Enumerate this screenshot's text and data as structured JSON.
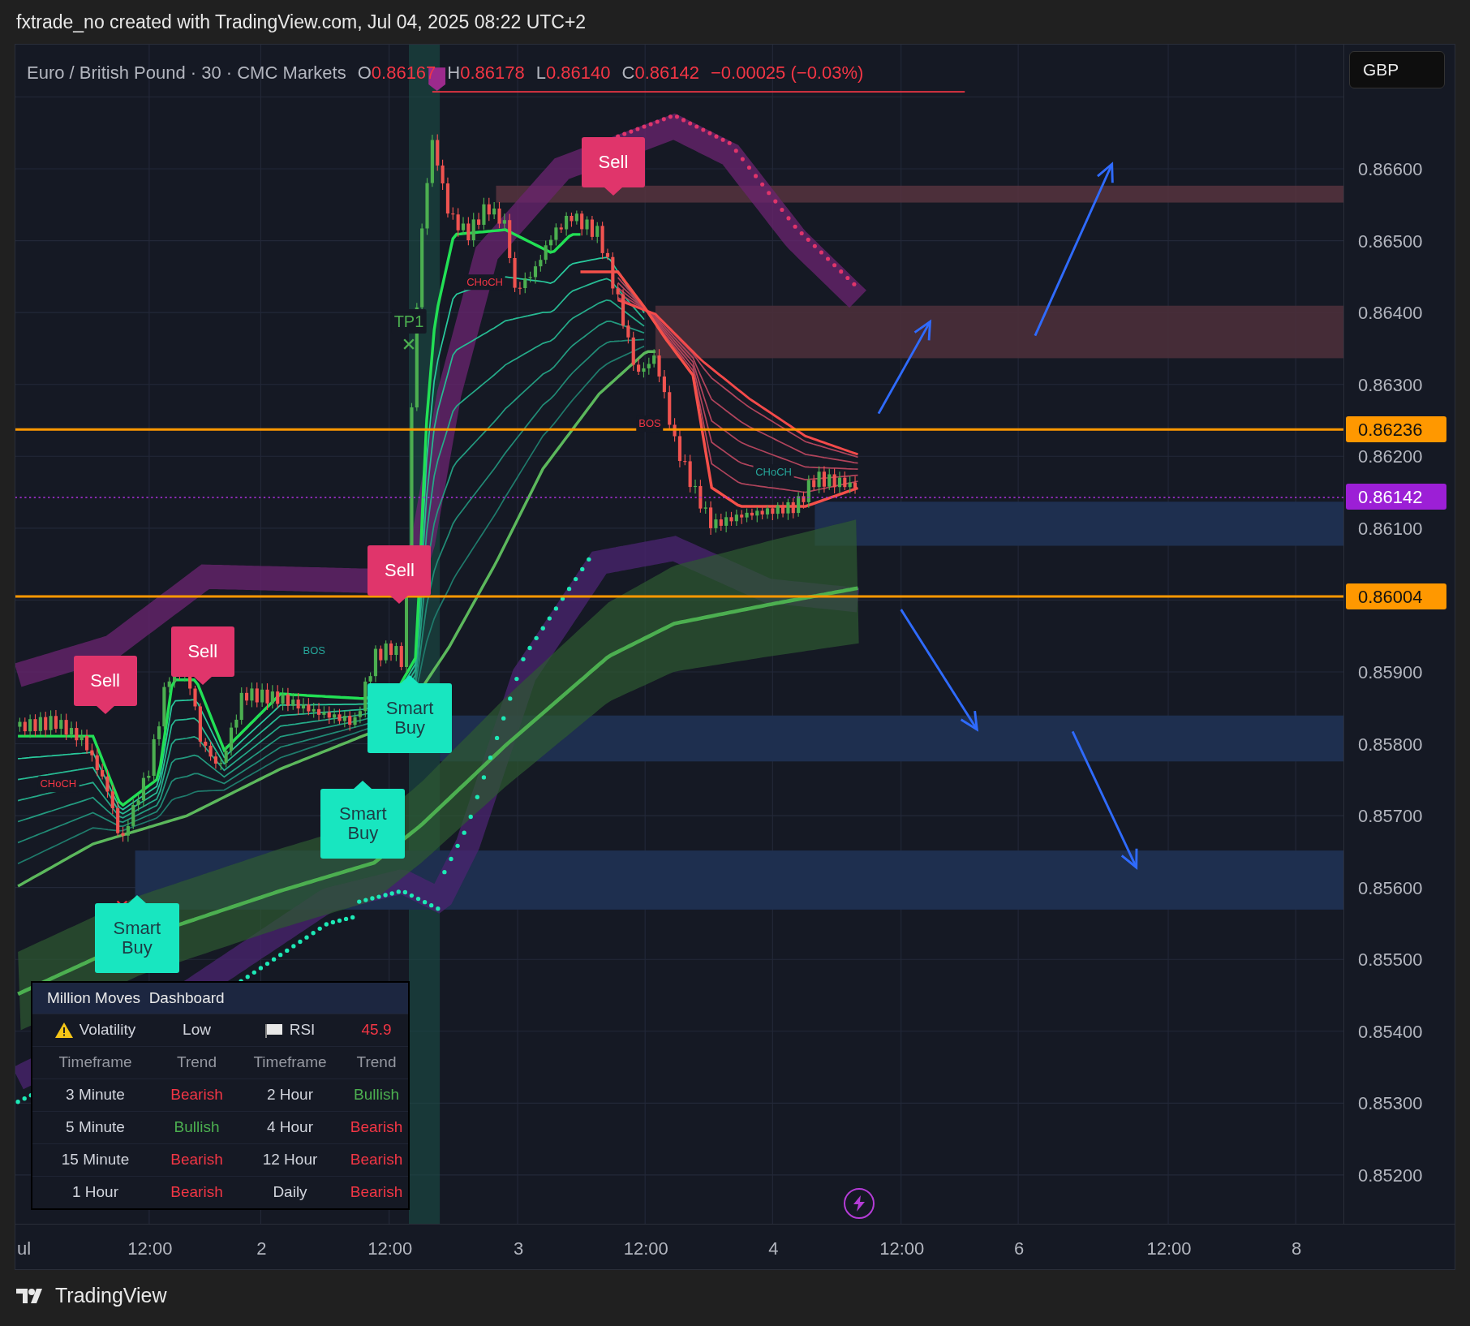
{
  "title_bar": {
    "text": "fxtrade_no created with TradingView.com, Jul 04, 2025 08:22 UTC+2"
  },
  "legend": {
    "symbol": "Euro / British Pound · 30 · CMC Markets",
    "ohlc": [
      {
        "label": "O",
        "value": "0.86167"
      },
      {
        "label": "H",
        "value": "0.86178"
      },
      {
        "label": "L",
        "value": "0.86140"
      },
      {
        "label": "C",
        "value": "0.86142"
      }
    ],
    "change": "−0.00025 (−0.03%)"
  },
  "currency_button": "GBP",
  "price_axis": {
    "labels": [
      "0.86600",
      "0.86500",
      "0.86400",
      "0.86300",
      "0.86200",
      "0.86100",
      "0.85900",
      "0.85800",
      "0.85700",
      "0.85600",
      "0.85500",
      "0.85400",
      "0.85300",
      "0.85200"
    ],
    "tags": [
      {
        "text": "0.86236",
        "color": "#ff9800"
      },
      {
        "text": "0.86142",
        "color": "#9c1fd6"
      },
      {
        "text": "0.86004",
        "color": "#ff9800"
      }
    ]
  },
  "time_axis": {
    "labels": [
      "ul",
      "12:00",
      "2",
      "12:00",
      "3",
      "12:00",
      "4",
      "12:00",
      "6",
      "12:00",
      "8"
    ]
  },
  "signals": [
    {
      "kind": "sell",
      "text": "Sell"
    },
    {
      "kind": "sell",
      "text": "Sell"
    },
    {
      "kind": "sell",
      "text": "Sell"
    },
    {
      "kind": "sell",
      "text": "Sell"
    },
    {
      "kind": "buy",
      "text": "Smart Buy"
    },
    {
      "kind": "buy",
      "text": "Smart Buy"
    },
    {
      "kind": "buy",
      "text": "Smart Buy"
    }
  ],
  "chart_labels": [
    {
      "text": "CHoCH",
      "color": "#f23645"
    },
    {
      "text": "CHoCH",
      "color": "#f23645"
    },
    {
      "text": "BOS",
      "color": "#26a69a"
    },
    {
      "text": "BOS",
      "color": "#f23645"
    },
    {
      "text": "CHoCH",
      "color": "#26a69a"
    },
    {
      "text": "TP1",
      "color": "#4caf50"
    }
  ],
  "dashboard": {
    "title": "Million Moves  Dashboard",
    "rows": [
      [
        {
          "text": "Volatility",
          "color": "#d1d4dc"
        },
        {
          "text": "Low",
          "color": "#d1d4dc"
        },
        {
          "text": "RSI",
          "color": "#d1d4dc"
        },
        {
          "text": "45.9",
          "color": "#f23645"
        }
      ],
      [
        {
          "text": "Timeframe",
          "color": "#9598a1"
        },
        {
          "text": "Trend",
          "color": "#9598a1"
        },
        {
          "text": "Timeframe",
          "color": "#9598a1"
        },
        {
          "text": "Trend",
          "color": "#9598a1"
        }
      ],
      [
        {
          "text": "3 Minute",
          "color": "#d1d4dc"
        },
        {
          "text": "Bearish",
          "color": "#f23645"
        },
        {
          "text": "2 Hour",
          "color": "#d1d4dc"
        },
        {
          "text": "Bullish",
          "color": "#4caf50"
        }
      ],
      [
        {
          "text": "5 Minute",
          "color": "#d1d4dc"
        },
        {
          "text": "Bullish",
          "color": "#4caf50"
        },
        {
          "text": "4 Hour",
          "color": "#d1d4dc"
        },
        {
          "text": "Bearish",
          "color": "#f23645"
        }
      ],
      [
        {
          "text": "15 Minute",
          "color": "#d1d4dc"
        },
        {
          "text": "Bearish",
          "color": "#f23645"
        },
        {
          "text": "12 Hour",
          "color": "#d1d4dc"
        },
        {
          "text": "Bearish",
          "color": "#f23645"
        }
      ],
      [
        {
          "text": "1 Hour",
          "color": "#d1d4dc"
        },
        {
          "text": "Bearish",
          "color": "#f23645"
        },
        {
          "text": "Daily",
          "color": "#d1d4dc"
        },
        {
          "text": "Bearish",
          "color": "#f23645"
        }
      ]
    ]
  },
  "footer": {
    "brand": "TradingView"
  }
}
